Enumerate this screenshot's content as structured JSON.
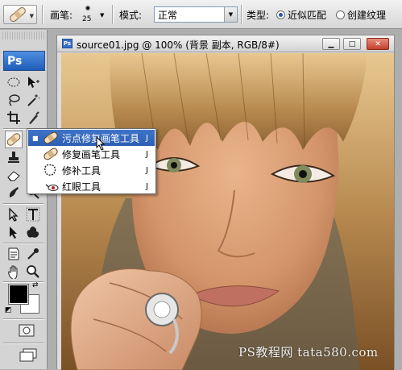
{
  "options_bar": {
    "brush_label": "画笔:",
    "brush_size": "25",
    "mode_label": "模式:",
    "mode_value": "正常",
    "type_label": "类型:",
    "type_options": [
      {
        "label": "近似匹配",
        "selected": true
      },
      {
        "label": "创建纹理",
        "selected": false
      }
    ]
  },
  "toolbox": {
    "logo": "Ps",
    "foreground_color": "#000000",
    "background_color": "#ffffff"
  },
  "document": {
    "title": "source01.jpg @ 100% (背景 副本, RGB/8#)",
    "icon_text": "Ps",
    "buttons": {
      "minimize": "▁",
      "maximize": "□",
      "close": "✕"
    }
  },
  "flyout": {
    "items": [
      {
        "label": "污点修复画笔工具",
        "shortcut": "J",
        "icon": "spot-healing-brush-icon",
        "active": true
      },
      {
        "label": "修复画笔工具",
        "shortcut": "J",
        "icon": "healing-brush-icon",
        "active": false
      },
      {
        "label": "修补工具",
        "shortcut": "J",
        "icon": "patch-icon",
        "active": false
      },
      {
        "label": "红眼工具",
        "shortcut": "J",
        "icon": "red-eye-icon",
        "active": false
      }
    ]
  },
  "watermark": "PS教程网 tata580.com",
  "colors": {
    "highlight": "#2d5fb3",
    "ps_blue": "#2a6bd0"
  }
}
